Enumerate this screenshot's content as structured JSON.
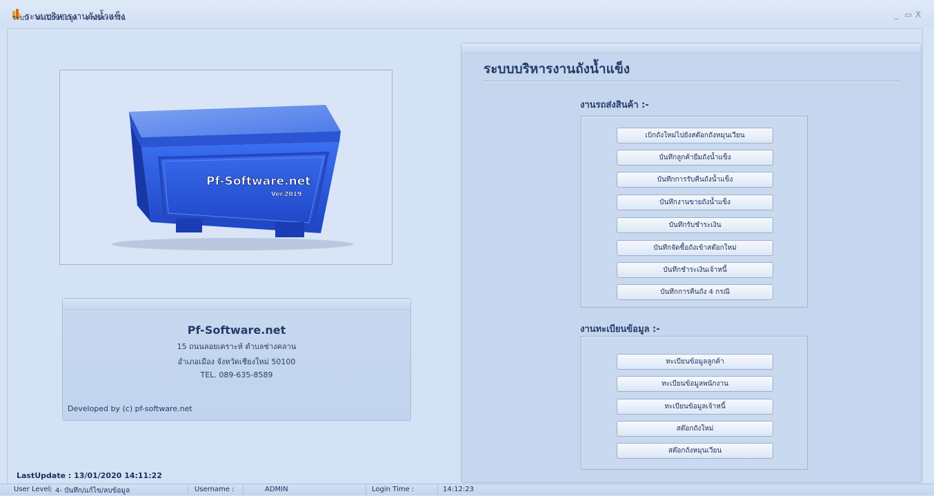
{
  "window": {
    "title": "ระบบบริหารงานถังน้ำแข็ง",
    "controls": {
      "minimize": "_",
      "maximize": "▭",
      "close": "X"
    }
  },
  "menu": [
    "ระบบ",
    "ทะเบียนข้อมูล",
    "งานประจำวัน"
  ],
  "image": {
    "brand": "Pf-Software.net",
    "version": "Ver.2019"
  },
  "company": {
    "name": "Pf-Software.net",
    "address1": "15 ถนนลอยเคราะห์ ตำบลช่างคลาน",
    "address2": "อำเภอเมือง จังหวัดเชียงใหม่ 50100",
    "tel": "TEL. 089-635-8589",
    "developed": "Developed by (c) pf-software.net"
  },
  "last_update": "LastUpdate : 13/01/2020 14:11:22",
  "panel": {
    "title": "ระบบบริหารงานถังน้ำแข็ง",
    "delivery": {
      "title": "งานรถส่งสินค้า :-",
      "buttons": [
        "เบิกถังใหม่ไปยังสต๊อกถังหมุนเวียน",
        "บันทึกลูกค้ายืมถังน้ำแข็ง",
        "บันทึกการรับคืนถังน้ำแข็ง",
        "บันทึกงานขายถังน้ำแข็ง",
        "บันทึกรับชำระเงิน",
        "บันทึกจัดซื้อถังเข้าสต๊อกใหม่",
        "บันทึกชำระเงินเจ้าหนี้",
        "บันทึกการคืนถัง 4 กรณี"
      ]
    },
    "registry": {
      "title": "งานทะเบียนข้อมูล :-",
      "buttons": [
        "ทะเบียนข้อมูลลูกค้า",
        "ทะเบียนข้อมูลพนักงาน",
        "ทะเบียนข้อมูลเจ้าหนี้",
        "สต๊อกถังใหม่",
        "สต๊อกถังหมุนเวียน"
      ]
    }
  },
  "status": {
    "user_level_label": "User Level:",
    "user_level": "4- บันทึก/แก้ไข/ลบข้อมูล",
    "username_label": "Username :",
    "username": "ADMIN",
    "login_time_label": "Login Time :",
    "login_time": "14:12:23"
  },
  "colors": {
    "background": "#d6e3f5",
    "panel": "#c5d6ee",
    "text": "#243c66",
    "cooler": "#2f5fe0"
  }
}
